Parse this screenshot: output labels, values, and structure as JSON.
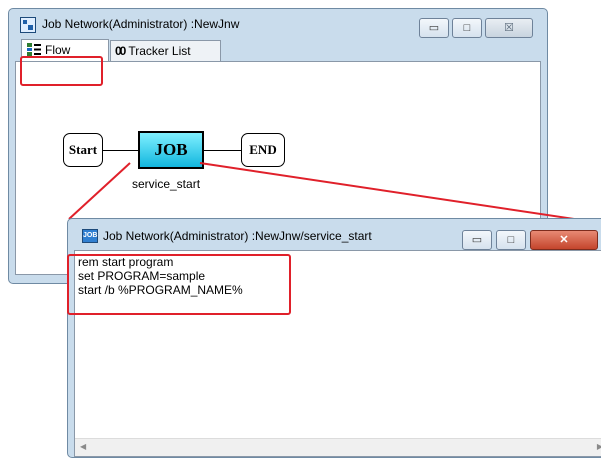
{
  "back_window": {
    "title": "Job Network(Administrator) :NewJnw",
    "controls": {
      "minimize": "▭",
      "maximize": "□",
      "close": "☒"
    },
    "tabs": [
      {
        "label": "Flow",
        "icon": "flow-icon",
        "active": true
      },
      {
        "label": "Tracker List",
        "icon": "eyes-icon",
        "active": false
      }
    ],
    "flow": {
      "start": "Start",
      "job": "JOB",
      "end": "END",
      "job_name": "service_start"
    }
  },
  "front_window": {
    "title": "Job Network(Administrator) :NewJnw/service_start",
    "icon_text": "JOB",
    "controls": {
      "minimize": "▭",
      "maximize": "□",
      "close": "✕"
    },
    "script_lines": [
      "rem start program",
      "set PROGRAM=sample",
      "start /b %PROGRAM_NAME%"
    ]
  },
  "colors": {
    "highlight": "#e0202a",
    "job_node": "#12b6de",
    "title_bar": "#c9dcec"
  }
}
